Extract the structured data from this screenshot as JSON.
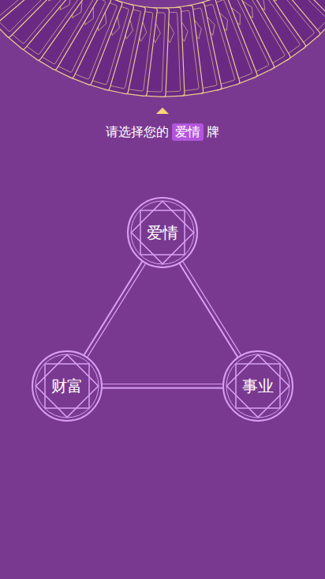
{
  "prompt": {
    "before": "请选择您的",
    "highlight": "爱情",
    "after": "牌"
  },
  "nodes": [
    {
      "label": "爱情"
    },
    {
      "label": "财富"
    },
    {
      "label": "事业"
    }
  ]
}
